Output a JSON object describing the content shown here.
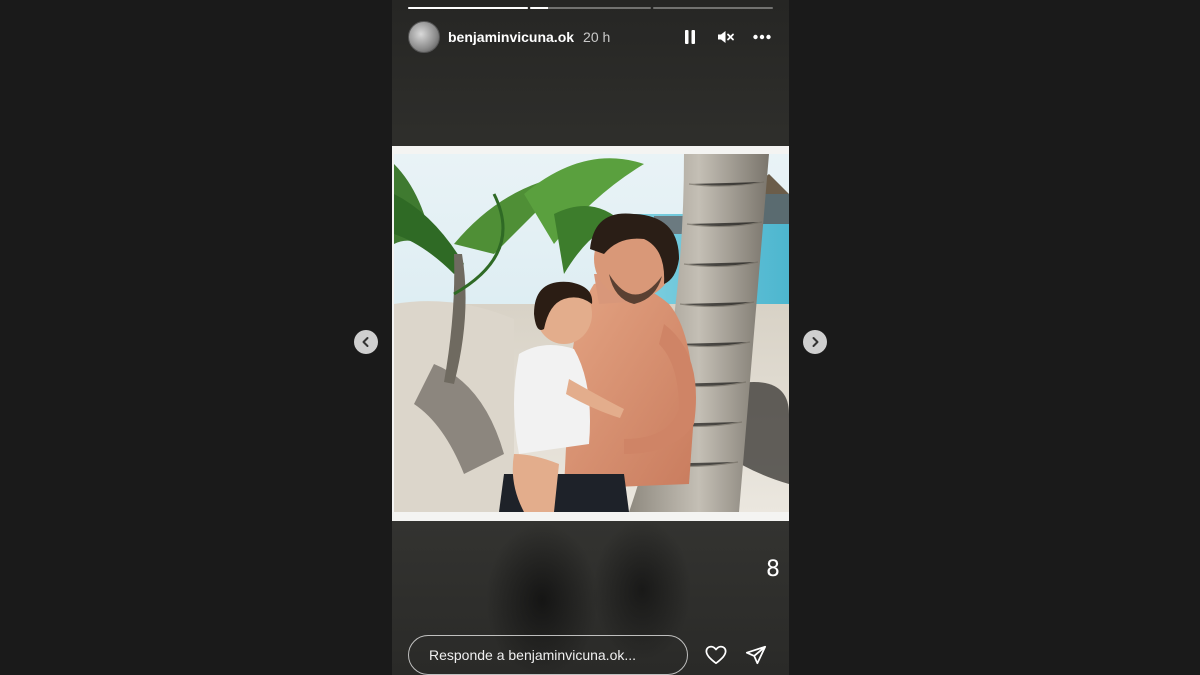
{
  "story": {
    "progress": [
      1,
      0.15,
      0
    ],
    "username": "benjaminvicuna.ok",
    "time_ago": "20 h",
    "page_number": "8",
    "reply_placeholder": "Responde a benjaminvicuna.ok..."
  },
  "icons": {
    "avatar": "profile-avatar",
    "pause": "pause-icon",
    "mute": "muted-speaker-icon",
    "more": "more-options-icon",
    "prev": "chevron-left-icon",
    "next": "chevron-right-icon",
    "like": "heart-icon",
    "share": "send-icon"
  },
  "colors": {
    "page_bg": "#1a1a1a",
    "nav_button": "#cfcfcf",
    "text": "#ffffff"
  }
}
